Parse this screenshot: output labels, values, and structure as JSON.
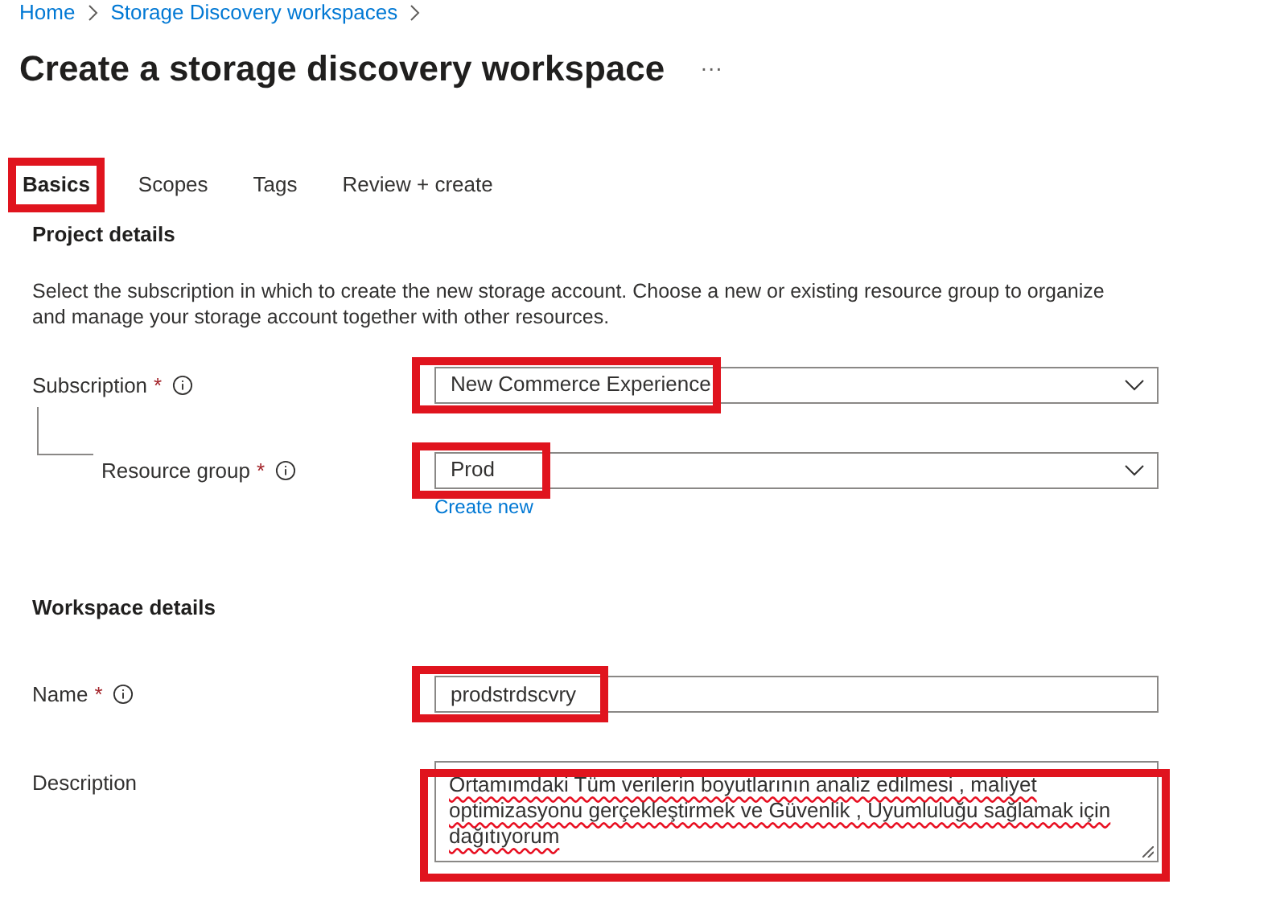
{
  "breadcrumb": [
    {
      "label": "Home"
    },
    {
      "label": "Storage Discovery workspaces"
    }
  ],
  "title": "Create a storage discovery workspace",
  "more": "···",
  "tabs": [
    {
      "label": "Basics",
      "selected": true,
      "highlighted": true
    },
    {
      "label": "Scopes",
      "selected": false,
      "highlighted": false
    },
    {
      "label": "Tags",
      "selected": false,
      "highlighted": false
    },
    {
      "label": "Review + create",
      "selected": false,
      "highlighted": false
    }
  ],
  "sections": [
    {
      "heading": "Project details",
      "intro": "Select the subscription in which to create the new storage account. Choose a new or existing resource group to organize and manage your storage account together with other resources.",
      "fields": [
        {
          "kind": "dropdown",
          "label": "Subscription",
          "required_mark": "*",
          "info": true,
          "indented": false,
          "value": "New Commerce Experience",
          "highlighted": true
        },
        {
          "kind": "dropdown",
          "label": "Resource group",
          "required_mark": "*",
          "info": true,
          "indented": true,
          "value": "Prod",
          "highlighted": true,
          "link": "Create new"
        }
      ]
    },
    {
      "heading": "Workspace details",
      "fields": [
        {
          "kind": "text",
          "label": "Name",
          "required_mark": "*",
          "info": true,
          "indented": false,
          "value": "prodstrdscvry",
          "highlighted": true
        },
        {
          "kind": "textarea",
          "label": "Description",
          "info": false,
          "indented": false,
          "value": "Ortamımdaki Tüm verilerin boyutlarının analiz edilmesi , maliyet optimizasyonu gerçekleştirmek ve Güvenlik , Uyumluluğu sağlamak için dağıtıyorum",
          "highlighted": true
        }
      ]
    }
  ]
}
